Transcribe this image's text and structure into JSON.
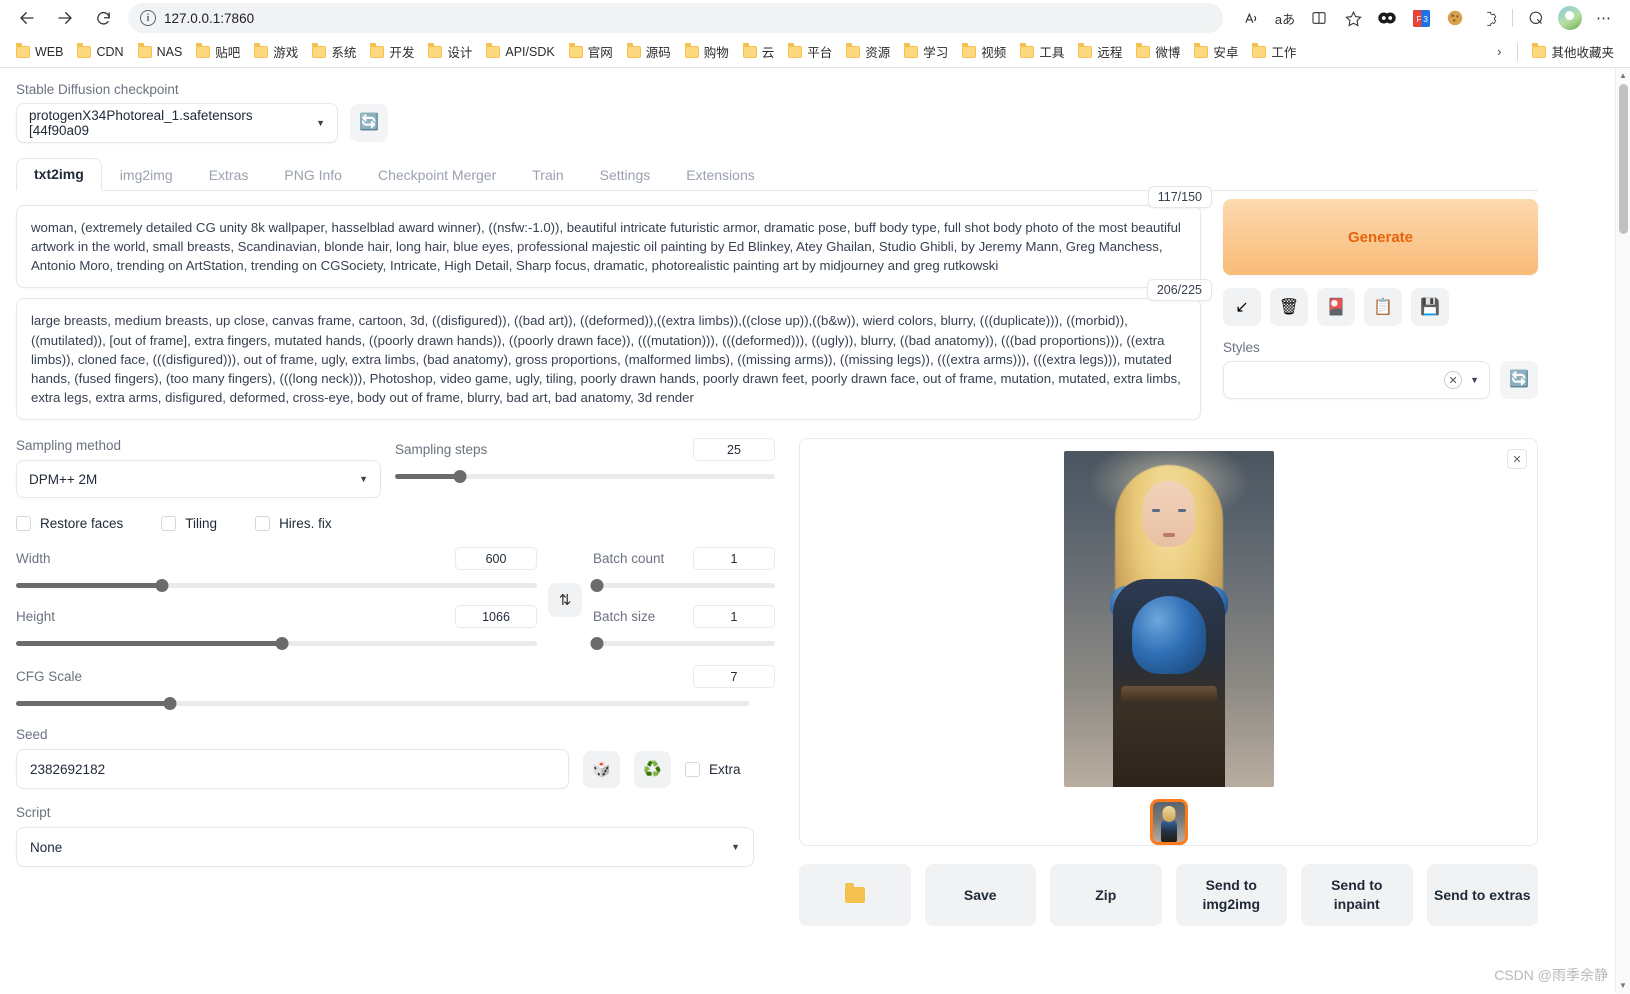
{
  "browser": {
    "back_icon": "back-arrow-icon",
    "forward_icon": "forward-arrow-icon",
    "reload_icon": "reload-icon",
    "url": "127.0.0.1:7860",
    "toolbar_icons": [
      "read-aloud-icon",
      "translate-icon",
      "split-screen-icon",
      "add-favorite-icon",
      "collections-icon",
      "extension-f3-icon",
      "cookie-icon",
      "browser-essentials-icon",
      "screenshot-icon",
      "profile-avatar",
      "settings-more-icon"
    ],
    "bookmarks": [
      "WEB",
      "CDN",
      "NAS",
      "贴吧",
      "游戏",
      "系统",
      "开发",
      "设计",
      "API/SDK",
      "官网",
      "源码",
      "购物",
      "云",
      "平台",
      "资源",
      "学习",
      "视频",
      "工具",
      "远程",
      "微博",
      "安卓",
      "工作"
    ],
    "bookmarks_overflow": "›",
    "other_bookmarks": "其他收藏夹"
  },
  "checkpoint": {
    "label": "Stable Diffusion checkpoint",
    "value": "protogenX34Photoreal_1.safetensors [44f90a09",
    "refresh_icon": "refresh-icon"
  },
  "tabs": [
    {
      "label": "txt2img",
      "active": true
    },
    {
      "label": "img2img",
      "active": false
    },
    {
      "label": "Extras",
      "active": false
    },
    {
      "label": "PNG Info",
      "active": false
    },
    {
      "label": "Checkpoint Merger",
      "active": false
    },
    {
      "label": "Train",
      "active": false
    },
    {
      "label": "Settings",
      "active": false
    },
    {
      "label": "Extensions",
      "active": false
    }
  ],
  "prompt": {
    "positive": "woman, (extremely detailed CG unity 8k wallpaper, hasselblad award winner), ((nsfw:-1.0)), beautiful intricate futuristic armor, dramatic pose, buff body type, full shot body photo of the most beautiful artwork in the world, small breasts, Scandinavian, blonde hair, long hair, blue eyes, professional majestic oil painting by Ed Blinkey, Atey Ghailan, Studio Ghibli, by Jeremy Mann, Greg Manchess, Antonio Moro, trending on ArtStation, trending on CGSociety, Intricate, High Detail, Sharp focus, dramatic, photorealistic painting art by midjourney and greg rutkowski",
    "positive_counter": "117/150",
    "negative": "large breasts, medium breasts, up close, canvas frame, cartoon, 3d, ((disfigured)), ((bad art)), ((deformed)),((extra limbs)),((close up)),((b&w)), wierd colors, blurry, (((duplicate))), ((morbid)), ((mutilated)), [out of frame], extra fingers, mutated hands, ((poorly drawn hands)), ((poorly drawn face)), (((mutation))), (((deformed))), ((ugly)), blurry, ((bad anatomy)), (((bad proportions))), ((extra limbs)), cloned face, (((disfigured))), out of frame, ugly, extra limbs, (bad anatomy), gross proportions, (malformed limbs), ((missing arms)), ((missing legs)), (((extra arms))), (((extra legs))), mutated hands, (fused fingers), (too many fingers), (((long neck))), Photoshop, video game, ugly, tiling, poorly drawn hands, poorly drawn feet, poorly drawn face, out of frame, mutation, mutated, extra limbs, extra legs, extra arms, disfigured, deformed, cross-eye, body out of frame, blurry, bad art, bad anatomy, 3d render",
    "negative_counter": "206/225"
  },
  "generate": {
    "label": "Generate",
    "tools": [
      {
        "name": "arrow-paste-icon",
        "glyph": "↙"
      },
      {
        "name": "trash-icon",
        "glyph": "🗑"
      },
      {
        "name": "extra-networks-icon",
        "glyph": "🎴"
      },
      {
        "name": "apply-style-icon",
        "glyph": "📋"
      },
      {
        "name": "save-style-icon",
        "glyph": "💾"
      }
    ],
    "styles_label": "Styles",
    "styles_value": "",
    "styles_clear_icon": "clear-x-icon",
    "styles_refresh_icon": "refresh-icon"
  },
  "settings": {
    "sampling_method_label": "Sampling method",
    "sampling_method_value": "DPM++ 2M",
    "sampling_steps_label": "Sampling steps",
    "sampling_steps_value": "25",
    "sampling_steps_pct": 17,
    "checkboxes": [
      {
        "label": "Restore faces",
        "checked": false
      },
      {
        "label": "Tiling",
        "checked": false
      },
      {
        "label": "Hires. fix",
        "checked": false
      }
    ],
    "width_label": "Width",
    "width_value": "600",
    "width_pct": 28,
    "height_label": "Height",
    "height_value": "1066",
    "height_pct": 51,
    "batch_count_label": "Batch count",
    "batch_count_value": "1",
    "batch_count_pct": 2,
    "batch_size_label": "Batch size",
    "batch_size_value": "1",
    "batch_size_pct": 2,
    "cfg_label": "CFG Scale",
    "cfg_value": "7",
    "cfg_pct": 21,
    "swap_icon": "swap-dimensions-icon",
    "seed_label": "Seed",
    "seed_value": "2382692182",
    "seed_random_icon": "dice-random-icon",
    "seed_recycle_icon": "recycle-reuse-icon",
    "extra_label": "Extra",
    "extra_checked": false,
    "script_label": "Script",
    "script_value": "None"
  },
  "result": {
    "close_icon": "close-icon",
    "thumbnail_name": "result-thumbnail",
    "buttons": [
      {
        "label": "",
        "name": "open-folder-button",
        "icon": "folder-icon"
      },
      {
        "label": "Save",
        "name": "save-button",
        "icon": ""
      },
      {
        "label": "Zip",
        "name": "zip-button",
        "icon": ""
      },
      {
        "label": "Send to img2img",
        "name": "send-to-img2img-button",
        "icon": ""
      },
      {
        "label": "Send to inpaint",
        "name": "send-to-inpaint-button",
        "icon": ""
      },
      {
        "label": "Send to extras",
        "name": "send-to-extras-button",
        "icon": ""
      }
    ]
  },
  "watermark": "CSDN @雨季余静",
  "colors": {
    "accent_orange": "#e8640c",
    "generate_gradient_start": "#fcd9b0",
    "generate_gradient_end": "#f9bb77",
    "refresh_blue": "#1e9bf0",
    "thumb_border": "#ff7a1a"
  }
}
